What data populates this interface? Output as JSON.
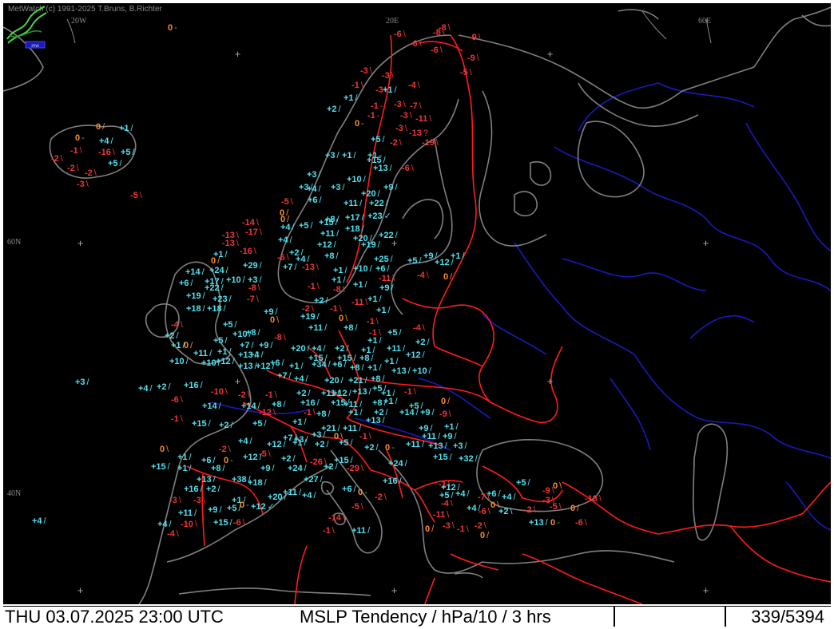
{
  "credit": "MetWatch  (c) 1991-2025 T.Bruns, B.Richter",
  "logo_caption": "mw",
  "grid_labels": {
    "lon_20w": "20W",
    "lon_20e": "20E",
    "lon_60e": "60E",
    "lat_60n": "60N",
    "lat_40n": "40N"
  },
  "status": {
    "datetime": "THU 03.07.2025 23:00 UTC",
    "product": "MSLP Tendency / hPa/10 / 3 hrs",
    "frame": "339/5394"
  },
  "colors": {
    "positive": "#52e2ef",
    "negative": "#ef3636",
    "zero": "#ff8c2a",
    "coastline": "#808080",
    "border": "#ff1c1c",
    "river": "#1a1ab8",
    "background": "#000000"
  },
  "stations": [
    {
      "value": "0",
      "symbol": "-"
    },
    {
      "value": "-6",
      "symbol": "\\"
    },
    {
      "value": "-8",
      "symbol": "\\"
    },
    {
      "value": "-8",
      "symbol": "\\"
    },
    {
      "value": "-9",
      "symbol": "\\"
    },
    {
      "value": "-6",
      "symbol": "\\"
    },
    {
      "value": "-6",
      "symbol": "\\"
    },
    {
      "value": "-9",
      "symbol": "\\"
    },
    {
      "value": "-3",
      "symbol": "\\"
    },
    {
      "value": "-5",
      "symbol": "\\"
    },
    {
      "value": "-3",
      "symbol": "\\"
    },
    {
      "value": "-1",
      "symbol": "\\"
    },
    {
      "value": "-4",
      "symbol": "\\"
    },
    {
      "value": "-3",
      "symbol": "\\"
    },
    {
      "value": "+1",
      "symbol": "/"
    },
    {
      "value": "+1",
      "symbol": "/"
    },
    {
      "value": "-1",
      "symbol": "-"
    },
    {
      "value": "-3",
      "symbol": "\\"
    },
    {
      "value": "-7",
      "symbol": "\\"
    },
    {
      "value": "+2",
      "symbol": "/"
    },
    {
      "value": "-1",
      "symbol": "-"
    },
    {
      "value": "-3",
      "symbol": "\\"
    },
    {
      "value": "-11",
      "symbol": "\\"
    },
    {
      "value": "0",
      "symbol": "-"
    },
    {
      "value": "0",
      "symbol": "/"
    },
    {
      "value": "+1",
      "symbol": "/"
    },
    {
      "value": "-3",
      "symbol": "\\"
    },
    {
      "value": "-13",
      "symbol": "?"
    },
    {
      "value": "0",
      "symbol": "-"
    },
    {
      "value": "+4",
      "symbol": "/"
    },
    {
      "value": "+5",
      "symbol": "/"
    },
    {
      "value": "-2",
      "symbol": "\\"
    },
    {
      "value": "-19",
      "symbol": "\\"
    },
    {
      "value": "-1",
      "symbol": "\\"
    },
    {
      "value": "-2",
      "symbol": "\\"
    },
    {
      "value": "-16",
      "symbol": "\\"
    },
    {
      "value": "+5",
      "symbol": "/"
    },
    {
      "value": "+5",
      "symbol": "/"
    },
    {
      "value": "+3",
      "symbol": "/"
    },
    {
      "value": "+1",
      "symbol": "/"
    },
    {
      "value": "+1",
      "symbol": "-"
    },
    {
      "value": "+15",
      "symbol": "/"
    },
    {
      "value": "-2",
      "symbol": "\\"
    },
    {
      "value": "-2",
      "symbol": "\\"
    },
    {
      "value": "-3",
      "symbol": "\\"
    },
    {
      "value": "+3",
      "symbol": "/"
    },
    {
      "value": "+13",
      "symbol": "/"
    },
    {
      "value": "-6",
      "symbol": "\\"
    },
    {
      "value": "+3",
      "symbol": "/"
    },
    {
      "value": "+10",
      "symbol": "/"
    },
    {
      "value": "-5",
      "symbol": "\\"
    },
    {
      "value": "+4",
      "symbol": "/"
    },
    {
      "value": "+3",
      "symbol": "/"
    },
    {
      "value": "+20",
      "symbol": "/"
    },
    {
      "value": "+9",
      "symbol": "/"
    },
    {
      "value": "-5",
      "symbol": "\\"
    },
    {
      "value": "+6",
      "symbol": "/"
    },
    {
      "value": "+11",
      "symbol": "/"
    },
    {
      "value": "+22",
      "symbol": "/"
    },
    {
      "value": "0",
      "symbol": "/"
    },
    {
      "value": "+4",
      "symbol": "/"
    },
    {
      "value": "+8",
      "symbol": "/"
    },
    {
      "value": "+17",
      "symbol": "/"
    },
    {
      "value": "+23",
      "symbol": "✓"
    },
    {
      "value": "0",
      "symbol": "/"
    },
    {
      "value": "+5",
      "symbol": "/"
    },
    {
      "value": "+15",
      "symbol": "/"
    },
    {
      "value": "-14",
      "symbol": "\\"
    },
    {
      "value": "-17",
      "symbol": "\\"
    },
    {
      "value": "-13",
      "symbol": "\\"
    },
    {
      "value": "+11",
      "symbol": "/"
    },
    {
      "value": "+18",
      "symbol": "/"
    },
    {
      "value": "+4",
      "symbol": "/"
    },
    {
      "value": "+20",
      "symbol": "/"
    },
    {
      "value": "+22",
      "symbol": "/"
    },
    {
      "value": "-13",
      "symbol": "\\"
    },
    {
      "value": "+12",
      "symbol": "/"
    },
    {
      "value": "+19",
      "symbol": "/"
    },
    {
      "value": "-16",
      "symbol": "\\"
    },
    {
      "value": "+2",
      "symbol": "/"
    },
    {
      "value": "+8",
      "symbol": "/"
    },
    {
      "value": "+1",
      "symbol": "/"
    },
    {
      "value": "+25",
      "symbol": "/"
    },
    {
      "value": "+9",
      "symbol": "/"
    },
    {
      "value": "+1",
      "symbol": "/"
    },
    {
      "value": "0",
      "symbol": "/"
    },
    {
      "value": "-6",
      "symbol": "\\"
    },
    {
      "value": "+4",
      "symbol": "/"
    },
    {
      "value": "+5",
      "symbol": "/"
    },
    {
      "value": "+12",
      "symbol": "/"
    },
    {
      "value": "+29",
      "symbol": "/"
    },
    {
      "value": "+7",
      "symbol": "/"
    },
    {
      "value": "-13",
      "symbol": "\\"
    },
    {
      "value": "+1",
      "symbol": "/"
    },
    {
      "value": "+10",
      "symbol": "/"
    },
    {
      "value": "+6",
      "symbol": "/"
    },
    {
      "value": "+14",
      "symbol": "/"
    },
    {
      "value": "+24",
      "symbol": "/"
    },
    {
      "value": "-4",
      "symbol": "\\"
    },
    {
      "value": "0",
      "symbol": "/"
    },
    {
      "value": "+17",
      "symbol": "/"
    },
    {
      "value": "+10",
      "symbol": "/"
    },
    {
      "value": "+3",
      "symbol": "/"
    },
    {
      "value": "+1",
      "symbol": "/"
    },
    {
      "value": "-11",
      "symbol": "\\"
    },
    {
      "value": "+6",
      "symbol": "/"
    },
    {
      "value": "+22",
      "symbol": "/"
    },
    {
      "value": "-8",
      "symbol": "\\"
    },
    {
      "value": "-1",
      "symbol": "\\"
    },
    {
      "value": "-8",
      "symbol": "\\"
    },
    {
      "value": "+1",
      "symbol": "/"
    },
    {
      "value": "+9",
      "symbol": "/"
    },
    {
      "value": "+19",
      "symbol": "/"
    },
    {
      "value": "+23",
      "symbol": "/"
    },
    {
      "value": "-7",
      "symbol": "\\"
    },
    {
      "value": "+2",
      "symbol": "/"
    },
    {
      "value": "-11",
      "symbol": "\\"
    },
    {
      "value": "+1",
      "symbol": "/"
    },
    {
      "value": "+18",
      "symbol": "/"
    },
    {
      "value": "+18",
      "symbol": "/"
    },
    {
      "value": "-2",
      "symbol": "\\"
    },
    {
      "value": "-1",
      "symbol": "\\"
    },
    {
      "value": "+1",
      "symbol": "/"
    },
    {
      "value": "+9",
      "symbol": "/"
    },
    {
      "value": "0",
      "symbol": "\\"
    },
    {
      "value": "+19",
      "symbol": "/"
    },
    {
      "value": "0",
      "symbol": "\\"
    },
    {
      "value": "-1",
      "symbol": "\\"
    },
    {
      "value": "-4",
      "symbol": "\\"
    },
    {
      "value": "+5",
      "symbol": "/"
    },
    {
      "value": "+11",
      "symbol": "/"
    },
    {
      "value": "-4",
      "symbol": "\\"
    },
    {
      "value": "+2",
      "symbol": "/"
    },
    {
      "value": "+8",
      "symbol": "/"
    },
    {
      "value": "-1",
      "symbol": "\\"
    },
    {
      "value": "+5",
      "symbol": "/"
    },
    {
      "value": "+1",
      "symbol": "/"
    },
    {
      "value": "0",
      "symbol": "/"
    },
    {
      "value": "+5",
      "symbol": "/"
    },
    {
      "value": "+10",
      "symbol": "/"
    },
    {
      "value": "+8",
      "symbol": "/"
    },
    {
      "value": "-8",
      "symbol": "\\"
    },
    {
      "value": "+1",
      "symbol": "/"
    },
    {
      "value": "+2",
      "symbol": "/"
    },
    {
      "value": "+11",
      "symbol": "/"
    },
    {
      "value": "+1",
      "symbol": "/"
    },
    {
      "value": "+7",
      "symbol": "/"
    },
    {
      "value": "+9",
      "symbol": "/"
    },
    {
      "value": "+20",
      "symbol": "/"
    },
    {
      "value": "+4",
      "symbol": "/"
    },
    {
      "value": "+2",
      "symbol": "/"
    },
    {
      "value": "+1",
      "symbol": "/"
    },
    {
      "value": "+11",
      "symbol": "/"
    },
    {
      "value": "+10",
      "symbol": "/"
    },
    {
      "value": "+10",
      "symbol": "/"
    },
    {
      "value": "+12",
      "symbol": "/"
    },
    {
      "value": "+13",
      "symbol": "/"
    },
    {
      "value": "+4",
      "symbol": "/"
    },
    {
      "value": "+15",
      "symbol": "/"
    },
    {
      "value": "+15",
      "symbol": "/"
    },
    {
      "value": "+8",
      "symbol": "/"
    },
    {
      "value": "+1",
      "symbol": "/"
    },
    {
      "value": "+12",
      "symbol": "/"
    },
    {
      "value": "+13",
      "symbol": "/"
    },
    {
      "value": "+12",
      "symbol": "/"
    },
    {
      "value": "+6",
      "symbol": "/"
    },
    {
      "value": "+1",
      "symbol": "/"
    },
    {
      "value": "+34",
      "symbol": "/"
    },
    {
      "value": "+6",
      "symbol": "/"
    },
    {
      "value": "+8",
      "symbol": "/"
    },
    {
      "value": "+1",
      "symbol": "/"
    },
    {
      "value": "+13",
      "symbol": "/"
    },
    {
      "value": "+10",
      "symbol": "/"
    },
    {
      "value": "+7",
      "symbol": "/"
    },
    {
      "value": "+4",
      "symbol": "/"
    },
    {
      "value": "+20",
      "symbol": "/"
    },
    {
      "value": "+21",
      "symbol": "/"
    },
    {
      "value": "+8",
      "symbol": "/"
    },
    {
      "value": "+3",
      "symbol": "/"
    },
    {
      "value": "+4",
      "symbol": "/"
    },
    {
      "value": "+2",
      "symbol": "/"
    },
    {
      "value": "+16",
      "symbol": "/"
    },
    {
      "value": "-10",
      "symbol": "\\"
    },
    {
      "value": "-2",
      "symbol": "\\"
    },
    {
      "value": "-1",
      "symbol": "\\"
    },
    {
      "value": "+2",
      "symbol": "/"
    },
    {
      "value": "+11",
      "symbol": "/"
    },
    {
      "value": "+12",
      "symbol": "/"
    },
    {
      "value": "+13",
      "symbol": "/"
    },
    {
      "value": "+5",
      "symbol": "/"
    },
    {
      "value": "+1",
      "symbol": "/"
    },
    {
      "value": "-1",
      "symbol": "\\"
    },
    {
      "value": "-6",
      "symbol": "\\"
    },
    {
      "value": "+14",
      "symbol": "/"
    },
    {
      "value": "+14",
      "symbol": "/"
    },
    {
      "value": "+8",
      "symbol": "/"
    },
    {
      "value": "+16",
      "symbol": "/"
    },
    {
      "value": "+15",
      "symbol": "/"
    },
    {
      "value": "+11",
      "symbol": "/"
    },
    {
      "value": "+8",
      "symbol": "/"
    },
    {
      "value": "+1",
      "symbol": "/"
    },
    {
      "value": "+5",
      "symbol": "/"
    },
    {
      "value": "0",
      "symbol": "/"
    },
    {
      "value": "-12",
      "symbol": "\\"
    },
    {
      "value": "-1",
      "symbol": "\\"
    },
    {
      "value": "+8",
      "symbol": "/"
    },
    {
      "value": "+1",
      "symbol": "/"
    },
    {
      "value": "+2",
      "symbol": "/"
    },
    {
      "value": "+14",
      "symbol": "/"
    },
    {
      "value": "+9",
      "symbol": "/"
    },
    {
      "value": "-9",
      "symbol": "\\"
    },
    {
      "value": "-1",
      "symbol": "\\"
    },
    {
      "value": "+15",
      "symbol": "/"
    },
    {
      "value": "+2",
      "symbol": "/"
    },
    {
      "value": "+5",
      "symbol": "/"
    },
    {
      "value": "+1",
      "symbol": "/"
    },
    {
      "value": "+21",
      "symbol": "/"
    },
    {
      "value": "+11",
      "symbol": "/"
    },
    {
      "value": "+13",
      "symbol": "/"
    },
    {
      "value": "+9",
      "symbol": "/"
    },
    {
      "value": "+1",
      "symbol": "/"
    },
    {
      "value": "+7",
      "symbol": "/"
    },
    {
      "value": "+3",
      "symbol": "/"
    },
    {
      "value": "+3",
      "symbol": "/"
    },
    {
      "value": "0",
      "symbol": "\\"
    },
    {
      "value": "-1",
      "symbol": "\\"
    },
    {
      "value": "+11",
      "symbol": "/"
    },
    {
      "value": "+9",
      "symbol": "/"
    },
    {
      "value": "+4",
      "symbol": "/"
    },
    {
      "value": "+12",
      "symbol": "/"
    },
    {
      "value": "+1",
      "symbol": "/"
    },
    {
      "value": "+2",
      "symbol": "/"
    },
    {
      "value": "+5",
      "symbol": "/"
    },
    {
      "value": "+2",
      "symbol": "/"
    },
    {
      "value": "0",
      "symbol": "-"
    },
    {
      "value": "+11",
      "symbol": "/"
    },
    {
      "value": "+13",
      "symbol": "/"
    },
    {
      "value": "+3",
      "symbol": "/"
    },
    {
      "value": "0",
      "symbol": "\\"
    },
    {
      "value": "-2",
      "symbol": "\\"
    },
    {
      "value": "-5",
      "symbol": "\\"
    },
    {
      "value": "+2",
      "symbol": "/"
    },
    {
      "value": "-26",
      "symbol": "\\"
    },
    {
      "value": "+15",
      "symbol": "/"
    },
    {
      "value": "+15",
      "symbol": "/"
    },
    {
      "value": "+1",
      "symbol": "/"
    },
    {
      "value": "+6",
      "symbol": "/"
    },
    {
      "value": "0",
      "symbol": "-"
    },
    {
      "value": "+12",
      "symbol": "/"
    },
    {
      "value": "-29",
      "symbol": "\\"
    },
    {
      "value": "+24",
      "symbol": "/"
    },
    {
      "value": "+32",
      "symbol": "/"
    },
    {
      "value": "+15",
      "symbol": "/"
    },
    {
      "value": "+1",
      "symbol": "/"
    },
    {
      "value": "+8",
      "symbol": "/"
    },
    {
      "value": "+9",
      "symbol": "/"
    },
    {
      "value": "+24",
      "symbol": "/"
    },
    {
      "value": "+27",
      "symbol": "/"
    },
    {
      "value": "+2",
      "symbol": "/"
    },
    {
      "value": "+13",
      "symbol": "/"
    },
    {
      "value": "+38",
      "symbol": "/"
    },
    {
      "value": "+18",
      "symbol": "/"
    },
    {
      "value": "+16",
      "symbol": "/"
    },
    {
      "value": "+2",
      "symbol": "/"
    },
    {
      "value": "+6",
      "symbol": "/"
    },
    {
      "value": "0",
      "symbol": "-"
    },
    {
      "value": "+4",
      "symbol": "/"
    },
    {
      "value": "-1",
      "symbol": "\\"
    },
    {
      "value": "+16",
      "symbol": "/"
    },
    {
      "value": "+12",
      "symbol": "/"
    },
    {
      "value": "+5",
      "symbol": "/"
    },
    {
      "value": "+6",
      "symbol": "/"
    },
    {
      "value": "+4",
      "symbol": "/"
    },
    {
      "value": "0",
      "symbol": "\\"
    },
    {
      "value": "-9",
      "symbol": "\\"
    },
    {
      "value": "-3",
      "symbol": "\\"
    },
    {
      "value": "-3",
      "symbol": "\\"
    },
    {
      "value": "+1",
      "symbol": "/"
    },
    {
      "value": "+12",
      "symbol": "✓"
    },
    {
      "value": "+20",
      "symbol": "/"
    },
    {
      "value": "+11",
      "symbol": "/"
    },
    {
      "value": "+5",
      "symbol": "/"
    },
    {
      "value": "+4",
      "symbol": "/"
    },
    {
      "value": "-7",
      "symbol": "\\"
    },
    {
      "value": "-4",
      "symbol": "\\"
    },
    {
      "value": "+4",
      "symbol": "/"
    },
    {
      "value": "0",
      "symbol": "\\"
    },
    {
      "value": "-3",
      "symbol": "\\"
    },
    {
      "value": "-18",
      "symbol": "\\"
    },
    {
      "value": "+4",
      "symbol": "/"
    },
    {
      "value": "+11",
      "symbol": "/"
    },
    {
      "value": "+9",
      "symbol": "/"
    },
    {
      "value": "+5",
      "symbol": "/"
    },
    {
      "value": "0",
      "symbol": "-"
    },
    {
      "value": "-14",
      "symbol": "\\"
    },
    {
      "value": "-5",
      "symbol": "\\"
    },
    {
      "value": "-2",
      "symbol": "\\"
    },
    {
      "value": "-11",
      "symbol": "\\"
    },
    {
      "value": "-6",
      "symbol": "\\"
    },
    {
      "value": "+2",
      "symbol": "\\"
    },
    {
      "value": "-2",
      "symbol": "\\"
    },
    {
      "value": "-5",
      "symbol": "\\"
    },
    {
      "value": "0",
      "symbol": "/"
    },
    {
      "value": "+4",
      "symbol": "/"
    },
    {
      "value": "-10",
      "symbol": "\\"
    },
    {
      "value": "+15",
      "symbol": "/"
    },
    {
      "value": "-6",
      "symbol": "\\"
    },
    {
      "value": "-3",
      "symbol": "\\"
    },
    {
      "value": "-2",
      "symbol": "\\"
    },
    {
      "value": "+13",
      "symbol": "/"
    },
    {
      "value": "0",
      "symbol": "-"
    },
    {
      "value": "-6",
      "symbol": "\\"
    },
    {
      "value": "-1",
      "symbol": "\\"
    },
    {
      "value": "+11",
      "symbol": "/"
    },
    {
      "value": "0",
      "symbol": "/"
    },
    {
      "value": "-1",
      "symbol": "\\"
    },
    {
      "value": "0",
      "symbol": "/"
    },
    {
      "value": "-4",
      "symbol": "\\"
    }
  ]
}
